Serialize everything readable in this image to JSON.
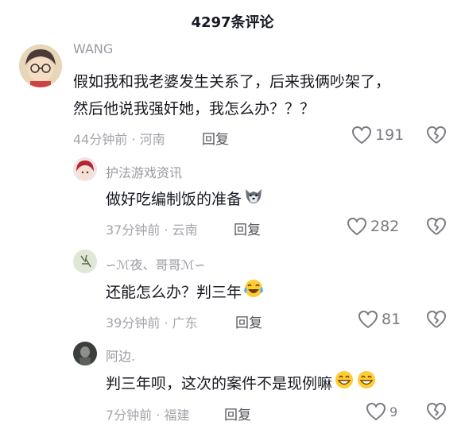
{
  "header": {
    "title": "4297条评论"
  },
  "comments": [
    {
      "author": "WANG",
      "lines": [
        "假如我和我老婆发生关系了，后来我俩吵架了，",
        "然后他说我强奸她，我怎么办？？？"
      ],
      "meta": "44分钟前 · 河南",
      "reply_label": "回复",
      "likes": "191"
    },
    {
      "author": "护法游戏资讯",
      "lines": [
        "做好吃编制饭的准备"
      ],
      "meta": "37分钟前 · 云南",
      "reply_label": "回复",
      "likes": "282"
    },
    {
      "author": "∽ℳ夜、哥哥ℳ∽",
      "lines": [
        "还能怎么办？判三年"
      ],
      "meta": "39分钟前 · 广东",
      "reply_label": "回复",
      "likes": "81"
    },
    {
      "author": "阿边.",
      "lines": [
        "判三年呗，这次的案件不是现例嘛"
      ],
      "meta": "7分钟前 · 福建",
      "reply_label": "回复",
      "likes": "9"
    }
  ],
  "icons": {
    "like": "heart-outline-icon",
    "dislike": "broken-heart-icon",
    "wolf_emoji": "wolf-emoji-icon",
    "crying_laugh_emoji": "tears-of-joy-emoji-icon",
    "grin_emoji": "grinning-emoji-icon"
  },
  "colors": {
    "text": "#161823",
    "secondary": "#a3a3ab",
    "icon": "#7a7a82"
  }
}
